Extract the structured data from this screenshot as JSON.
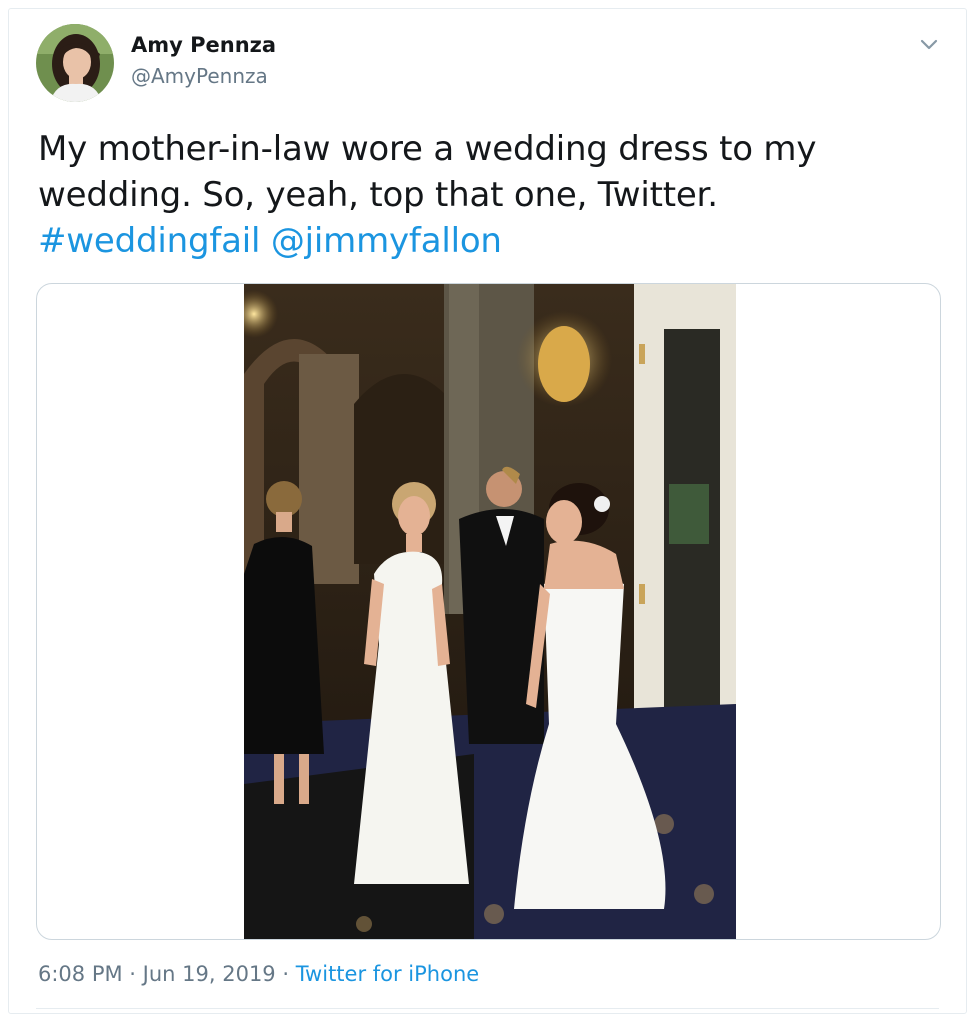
{
  "tweet": {
    "author_name": "Amy Pennza",
    "author_handle": "@AmyPennza",
    "text_plain": "My mother-in-law wore a wedding dress to my wedding. So, yeah, top that one, Twitter.",
    "hashtag": "#weddingfail",
    "mention": "@jimmyfallon",
    "time": "6:08 PM",
    "sep1": " · ",
    "date": "Jun 19, 2019",
    "sep2": " · ",
    "source": "Twitter for iPhone"
  },
  "icons": {
    "menu": "chevron-down-icon"
  },
  "colors": {
    "link": "#1b95e0",
    "secondary_text": "#657786",
    "border": "#e6ecf0"
  }
}
